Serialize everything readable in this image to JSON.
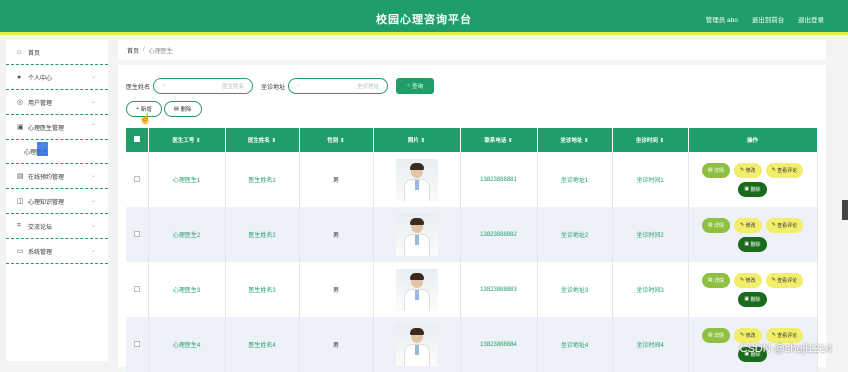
{
  "header": {
    "title": "校园心理咨询平台",
    "admin_label": "管理员 abo",
    "back_label": "退出到前台",
    "logout_label": "退出登录"
  },
  "sidebar": {
    "items": [
      {
        "icon": "home-icon",
        "label": "首页",
        "glyph": "⌂"
      },
      {
        "icon": "user-icon",
        "label": "个人中心",
        "glyph": "●"
      },
      {
        "icon": "users-icon",
        "label": "用户管理",
        "glyph": "◎"
      },
      {
        "icon": "briefcase-icon",
        "label": "心理医生管理",
        "glyph": "▣"
      },
      {
        "icon": "calendar-icon",
        "label": "在线预约管理",
        "glyph": "▤"
      },
      {
        "icon": "book-icon",
        "label": "心理知识管理",
        "glyph": "◫"
      },
      {
        "icon": "forum-icon",
        "label": "交流论坛",
        "glyph": "⌗"
      },
      {
        "icon": "settings-icon",
        "label": "系统管理",
        "glyph": "▭"
      }
    ],
    "sub_item": "心理医生"
  },
  "breadcrumb": {
    "home": "首页",
    "sep": "/",
    "current": "心理医生"
  },
  "search": {
    "name_label": "医生姓名",
    "name_placeholder": "医生姓名",
    "addr_label": "坐诊地址",
    "addr_placeholder": "坐诊地址",
    "query_label": "查询"
  },
  "toolbar": {
    "add_label": "新增",
    "delete_label": "删除"
  },
  "table": {
    "headers": [
      "医生工号",
      "医生姓名",
      "性别",
      "照片",
      "联系电话",
      "坐诊地址",
      "坐诊时间",
      "操作"
    ],
    "rows": [
      {
        "id": "心理医生1",
        "name": "医生姓名1",
        "sex": "男",
        "phone": "13823888881",
        "addr": "坐诊地址1",
        "time": "坐诊时间1"
      },
      {
        "id": "心理医生2",
        "name": "医生姓名2",
        "sex": "男",
        "phone": "13823888882",
        "addr": "坐诊地址2",
        "time": "坐诊时间2"
      },
      {
        "id": "心理医生3",
        "name": "医生姓名3",
        "sex": "男",
        "phone": "13823888883",
        "addr": "坐诊地址3",
        "time": "坐诊时间3"
      },
      {
        "id": "心理医生4",
        "name": "医生姓名4",
        "sex": "男",
        "phone": "13823888884",
        "addr": "坐诊地址4",
        "time": "坐诊时间4"
      }
    ],
    "ops": {
      "detail": "详情",
      "edit": "修改",
      "review": "查看评论",
      "delete": "删除"
    }
  },
  "watermark": "CSDN @sheji1214",
  "colors": {
    "primary": "#1f9e6a",
    "accent_bar": "#e5ee41",
    "edit": "#f2ee6c",
    "detail": "#8fc042",
    "delete": "#1a6b1e"
  }
}
